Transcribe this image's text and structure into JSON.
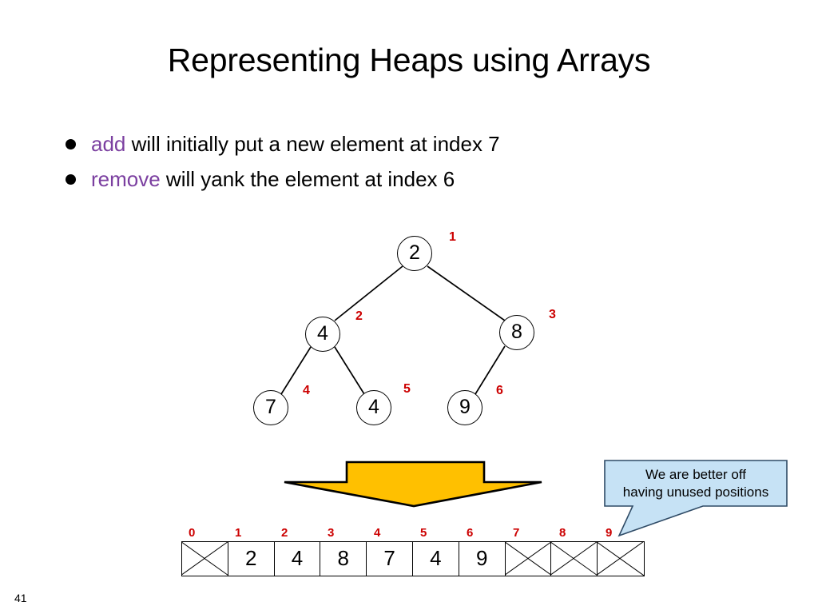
{
  "slide": {
    "title": "Representing Heaps using Arrays",
    "page_number": "41",
    "accent_red": "#CC0000",
    "keyword_purple": "#7B3FA0",
    "arrow_fill": "#FFC000",
    "callout_fill": "#C6E2F5"
  },
  "bullets": [
    {
      "keyword": "add",
      "rest": " will initially put a new element at index 7"
    },
    {
      "keyword": "remove",
      "rest": " will yank the element at index 6"
    }
  ],
  "tree": {
    "nodes": [
      {
        "value": "2",
        "index_label": "1"
      },
      {
        "value": "4",
        "index_label": "2"
      },
      {
        "value": "8",
        "index_label": "3"
      },
      {
        "value": "7",
        "index_label": "4"
      },
      {
        "value": "4",
        "index_label": "5"
      },
      {
        "value": "9",
        "index_label": "6"
      }
    ]
  },
  "array": {
    "indices": [
      "0",
      "1",
      "2",
      "3",
      "4",
      "5",
      "6",
      "7",
      "8",
      "9"
    ],
    "cells": [
      {
        "value": "",
        "empty": true
      },
      {
        "value": "2",
        "empty": false
      },
      {
        "value": "4",
        "empty": false
      },
      {
        "value": "8",
        "empty": false
      },
      {
        "value": "7",
        "empty": false
      },
      {
        "value": "4",
        "empty": false
      },
      {
        "value": "9",
        "empty": false
      },
      {
        "value": "",
        "empty": true
      },
      {
        "value": "",
        "empty": true
      },
      {
        "value": "",
        "empty": true
      }
    ]
  },
  "callout": {
    "line1": "We are better off",
    "line2": "having unused positions"
  }
}
